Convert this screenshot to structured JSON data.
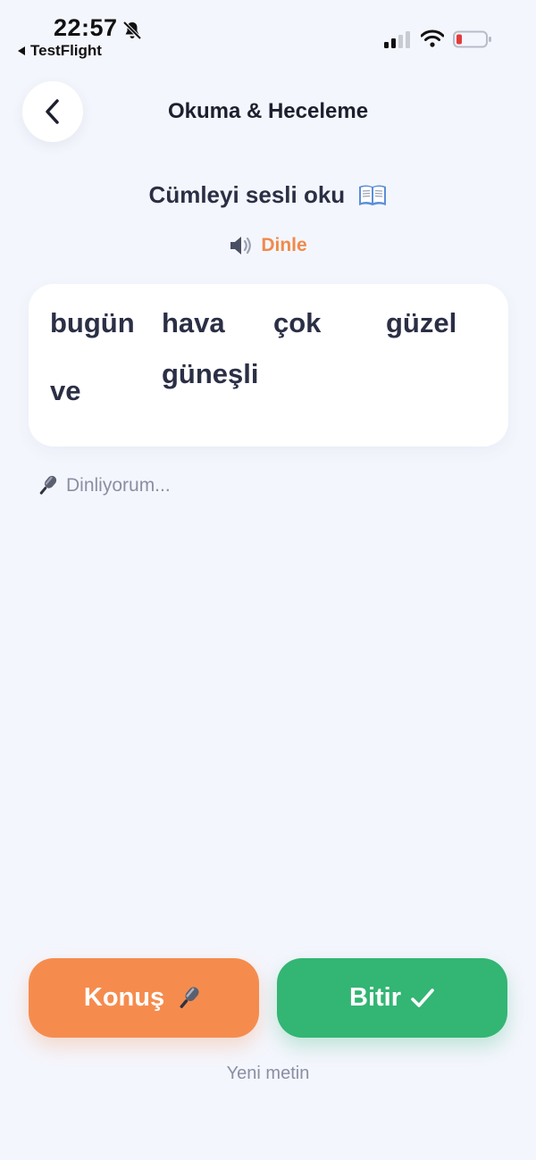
{
  "status_bar": {
    "time": "22:57",
    "back_app": "TestFlight",
    "battery_color": "#e33b3b"
  },
  "header": {
    "title": "Okuma & Heceleme"
  },
  "prompt": {
    "title": "Cümleyi sesli oku",
    "listen_label": "Dinle"
  },
  "words": [
    "bugün",
    "hava",
    "çok",
    "güzel",
    "ve",
    "güneşli"
  ],
  "listening": {
    "text": "Dinliyorum..."
  },
  "actions": {
    "speak_label": "Konuş",
    "finish_label": "Bitir",
    "new_text_label": "Yeni metin"
  },
  "colors": {
    "background": "#f4f6fd",
    "accent_orange": "#f58c4e",
    "accent_green": "#33b573",
    "text_dark": "#2b2f45",
    "text_muted": "#8b8fa3"
  },
  "icons": {
    "status": [
      "bell-off-icon",
      "signal-icon",
      "wifi-icon",
      "battery-icon"
    ],
    "prompt": "book-icon",
    "listen": "speaker-icon",
    "listening": "microphone-icon",
    "speak": "microphone-icon",
    "finish": "checkmark-icon"
  }
}
